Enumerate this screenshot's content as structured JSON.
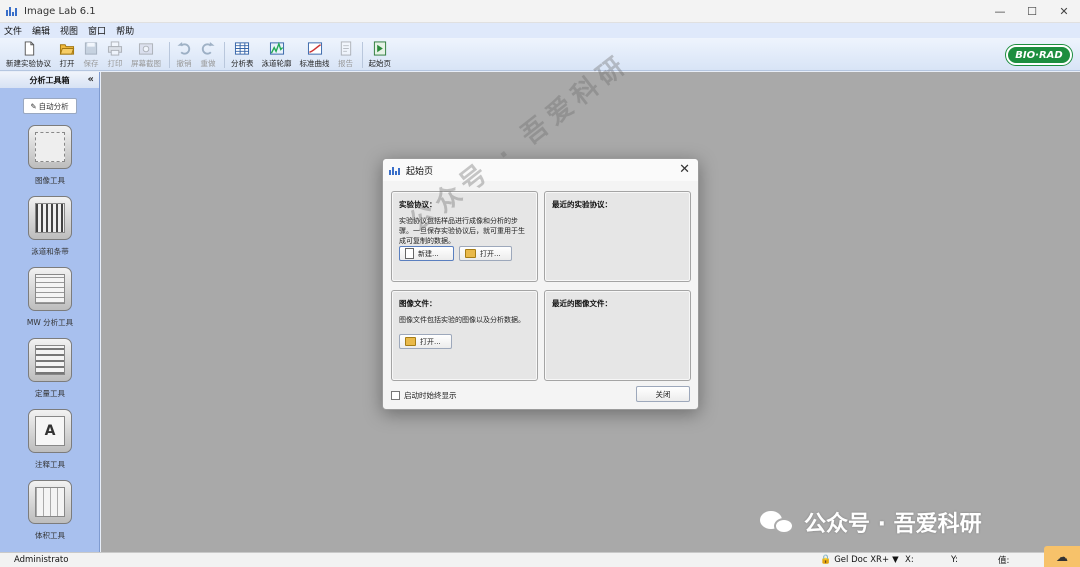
{
  "window": {
    "title": "Image Lab 6.1",
    "controls": {
      "minimize": "—",
      "maximize": "☐",
      "close": "✕"
    }
  },
  "menu": [
    "文件",
    "编辑",
    "视图",
    "窗口",
    "帮助"
  ],
  "toolbar": {
    "items": [
      {
        "label": "新建实验协议",
        "icon": "new-document-icon",
        "enabled": true
      },
      {
        "label": "打开",
        "icon": "open-folder-icon",
        "enabled": true
      },
      {
        "label": "保存",
        "icon": "save-icon",
        "enabled": false
      },
      {
        "label": "打印",
        "icon": "print-icon",
        "enabled": false
      },
      {
        "label": "屏幕截图",
        "icon": "screenshot-icon",
        "enabled": false
      },
      {
        "label": "撤销",
        "icon": "undo-icon",
        "enabled": false
      },
      {
        "label": "重做",
        "icon": "redo-icon",
        "enabled": false
      },
      {
        "label": "分析表",
        "icon": "analysis-table-icon",
        "enabled": true
      },
      {
        "label": "泳道轮廓",
        "icon": "lane-profile-icon",
        "enabled": true
      },
      {
        "label": "标准曲线",
        "icon": "standard-curve-icon",
        "enabled": true
      },
      {
        "label": "报告",
        "icon": "report-icon",
        "enabled": false
      },
      {
        "label": "起始页",
        "icon": "start-page-icon",
        "enabled": true
      }
    ],
    "brand": "BIO·RAD"
  },
  "sidebar": {
    "title": "分析工具箱",
    "collapse": "«",
    "auto_analyze": "自动分析",
    "tools": [
      {
        "label": "图像工具",
        "icon": "image-tools-icon"
      },
      {
        "label": "泳道和条带",
        "icon": "lanes-bands-icon"
      },
      {
        "label": "MW 分析工具",
        "icon": "mw-analysis-icon"
      },
      {
        "label": "定量工具",
        "icon": "quantity-tools-icon"
      },
      {
        "label": "注释工具",
        "icon": "annotation-tools-icon"
      },
      {
        "label": "体积工具",
        "icon": "volume-tools-icon"
      }
    ]
  },
  "dialog": {
    "title": "起始页",
    "close": "✕",
    "protocol": {
      "heading": "实验协议：",
      "desc": "实验协议包括样品进行成像和分析的步骤。一旦保存实验协议后，就可重用于生成可复制的数据。",
      "new_label": "新建...",
      "open_label": "打开..."
    },
    "recent_protocols": {
      "heading": "最近的实验协议："
    },
    "image_file": {
      "heading": "图像文件：",
      "desc": "图像文件包括实验的图像以及分析数据。",
      "open_label": "打开..."
    },
    "recent_images": {
      "heading": "最近的图像文件："
    },
    "startup_checkbox": "启动时始终显示",
    "startup_checked": false,
    "close_button": "关闭"
  },
  "status": {
    "user": "Administrato",
    "device": "Gel Doc XR+",
    "x_label": "X:",
    "y_label": "Y:",
    "value_label": "值:"
  },
  "watermark": {
    "diagonal": "公众号 · 吾爱科研",
    "corner": "公众号 · 吾爱科研"
  }
}
